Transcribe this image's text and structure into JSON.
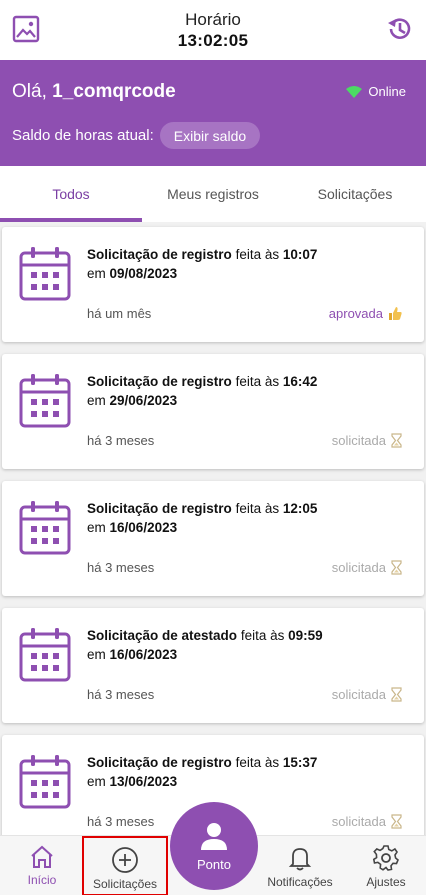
{
  "header": {
    "time_label": "Horário",
    "time_value": "13:02:05",
    "left_icon": "image-icon",
    "right_icon": "history-icon"
  },
  "user": {
    "greeting_prefix": "Olá,",
    "username": "1_comqrcode",
    "status": "Online",
    "balance_label": "Saldo de horas atual:",
    "balance_button": "Exibir saldo"
  },
  "tabs": [
    {
      "label": "Todos",
      "active": true
    },
    {
      "label": "Meus registros",
      "active": false
    },
    {
      "label": "Solicitações",
      "active": false
    }
  ],
  "items": [
    {
      "type": "Solicitação de registro",
      "made_at": "feita às",
      "time": "10:07",
      "on": "em",
      "date": "09/08/2023",
      "ago": "há um mês",
      "status": "aprovada",
      "status_icon": "thumbs-up-icon"
    },
    {
      "type": "Solicitação de registro",
      "made_at": "feita às",
      "time": "16:42",
      "on": "em",
      "date": "29/06/2023",
      "ago": "há 3 meses",
      "status": "solicitada",
      "status_icon": "hourglass-icon"
    },
    {
      "type": "Solicitação de registro",
      "made_at": "feita às",
      "time": "12:05",
      "on": "em",
      "date": "16/06/2023",
      "ago": "há 3 meses",
      "status": "solicitada",
      "status_icon": "hourglass-icon"
    },
    {
      "type": "Solicitação de atestado",
      "made_at": "feita às",
      "time": "09:59",
      "on": "em",
      "date": "16/06/2023",
      "ago": "há 3 meses",
      "status": "solicitada",
      "status_icon": "hourglass-icon"
    },
    {
      "type": "Solicitação de registro",
      "made_at": "feita às",
      "time": "15:37",
      "on": "em",
      "date": "13/06/2023",
      "ago": "há 3 meses",
      "status": "solicitada",
      "status_icon": "hourglass-icon"
    }
  ],
  "nav": {
    "inicio": "Início",
    "solicitacoes": "Solicitações",
    "ponto": "Ponto",
    "notificacoes": "Notificações",
    "ajustes": "Ajustes"
  },
  "colors": {
    "brand": "#8e4fb1",
    "online": "#4cd964",
    "highlight": "#e00000"
  }
}
